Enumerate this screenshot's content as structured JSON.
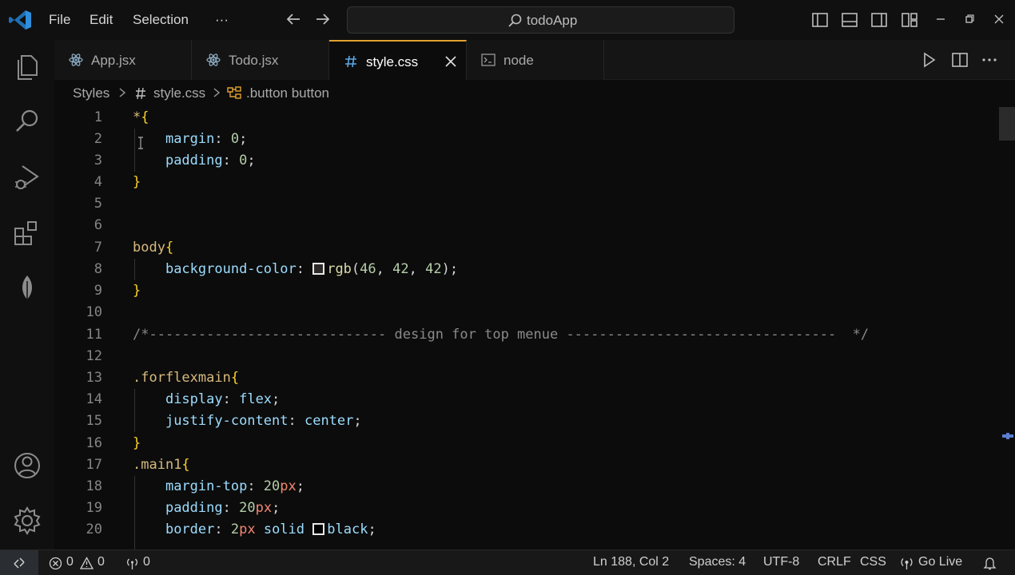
{
  "titlebar": {
    "menu": [
      "File",
      "Edit",
      "Selection"
    ],
    "more": "···",
    "search_text": "todoApp",
    "icons": [
      "vscode-logo-icon",
      "back-arrow-icon",
      "forward-arrow-icon",
      "search-icon",
      "toggle-primary-sidebar-icon",
      "toggle-panel-icon",
      "toggle-secondary-sidebar-icon",
      "customize-layout-icon",
      "minimize-icon",
      "restore-icon",
      "close-icon"
    ]
  },
  "activitybar": {
    "items": [
      "explorer-icon",
      "search-icon",
      "run-debug-icon",
      "extensions-icon",
      "mongodb-leaf-icon"
    ],
    "bottom": [
      "accounts-icon",
      "settings-gear-icon"
    ]
  },
  "tabs": [
    {
      "label": "App.jsx",
      "icon": "react-icon",
      "active": false
    },
    {
      "label": "Todo.jsx",
      "icon": "react-icon",
      "active": false
    },
    {
      "label": "style.css",
      "icon": "hash-icon",
      "active": true
    },
    {
      "label": "node",
      "icon": "terminal-icon",
      "active": false
    }
  ],
  "breadcrumb": {
    "folder": "Styles",
    "file": "style.css",
    "symbol": ".button button"
  },
  "code_lines": [
    {
      "n": "1"
    },
    {
      "n": "2"
    },
    {
      "n": "3"
    },
    {
      "n": "4"
    },
    {
      "n": "5"
    },
    {
      "n": "6"
    },
    {
      "n": "7"
    },
    {
      "n": "8"
    },
    {
      "n": "9"
    },
    {
      "n": "10"
    },
    {
      "n": "11"
    },
    {
      "n": "12"
    },
    {
      "n": "13"
    },
    {
      "n": "14"
    },
    {
      "n": "15"
    },
    {
      "n": "16"
    },
    {
      "n": "17"
    },
    {
      "n": "18"
    },
    {
      "n": "19"
    },
    {
      "n": "20"
    }
  ],
  "code": {
    "l1": [
      "*",
      "{"
    ],
    "l2": [
      "margin",
      ": ",
      "0",
      ";"
    ],
    "l3": [
      "padding",
      ": ",
      "0",
      ";"
    ],
    "l4": [
      "}"
    ],
    "l7": [
      "body",
      "{"
    ],
    "l8": [
      "background-color",
      ": ",
      "rgb",
      "(",
      "46",
      ", ",
      "42",
      ", ",
      "42",
      ");"
    ],
    "l9": [
      "}"
    ],
    "l11": [
      "/*----------------------------- design for top menue ---------------------------------  */"
    ],
    "l13": [
      ".forflexmain",
      "{"
    ],
    "l14": [
      "display",
      ": ",
      "flex",
      ";"
    ],
    "l15": [
      "justify-content",
      ": ",
      "center",
      ";"
    ],
    "l16": [
      "}"
    ],
    "l17": [
      ".main1",
      "{"
    ],
    "l18": [
      "margin-top",
      ": ",
      "20",
      "px",
      ";"
    ],
    "l19": [
      "padding",
      ": ",
      "20",
      "px",
      ";"
    ],
    "l20": [
      "border",
      ": ",
      "2",
      "px",
      " solid ",
      "black",
      ";"
    ]
  },
  "statusbar": {
    "errors": "0",
    "warnings": "0",
    "ports": "0",
    "position": "Ln 188, Col 2",
    "spaces": "Spaces: 4",
    "encoding": "UTF-8",
    "eol": "CRLF",
    "language": "CSS",
    "golive": "Go Live"
  },
  "colors": {
    "accent_tab": "#e2a12e",
    "selector": "#d7ba7d",
    "property": "#9cdcfe",
    "number": "#b5cea8",
    "value": "#ce9178",
    "brace": "#fcd22a"
  }
}
